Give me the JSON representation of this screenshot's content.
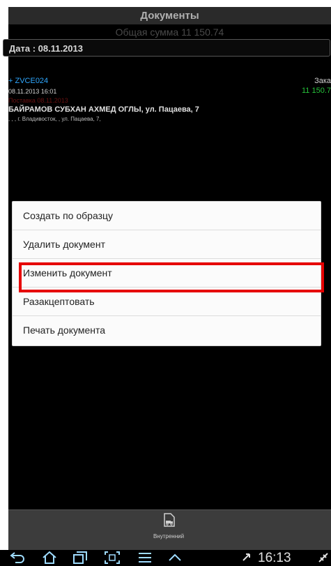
{
  "app": {
    "title": "Документы",
    "total": "Общая сумма 11 150.74",
    "date_filter": "Дата : 08.11.2013"
  },
  "document": {
    "number": "+ ZVCE024",
    "status": "Зака",
    "datetime": "08.11.2013 16:01",
    "amount": "11 150.7",
    "delivery": "Поставка 08.11.2013",
    "client": "БАЙРАМОВ СУБХАН АХМЕД ОГЛЫ, ул. Пацаева, 7",
    "address": ", , , г. Владивосток, , ул. Пацаева, 7,"
  },
  "context_menu": {
    "items": [
      "Создать по образцу",
      "Удалить документ",
      "Изменить документ",
      "Разакцептовать",
      "Печать документа"
    ],
    "highlighted_index": 2
  },
  "bottom_tab": {
    "label": "Внутренний"
  },
  "system_bar": {
    "time": "16:13",
    "nav_icons": [
      "back-icon",
      "home-icon",
      "recent-apps-icon",
      "screenshot-icon",
      "menu-icon",
      "up-chevron-icon"
    ]
  },
  "colors": {
    "document_number": "#2fa8ff",
    "amount": "#26c23a",
    "delivery": "#6a1111",
    "highlight": "#e60000"
  }
}
